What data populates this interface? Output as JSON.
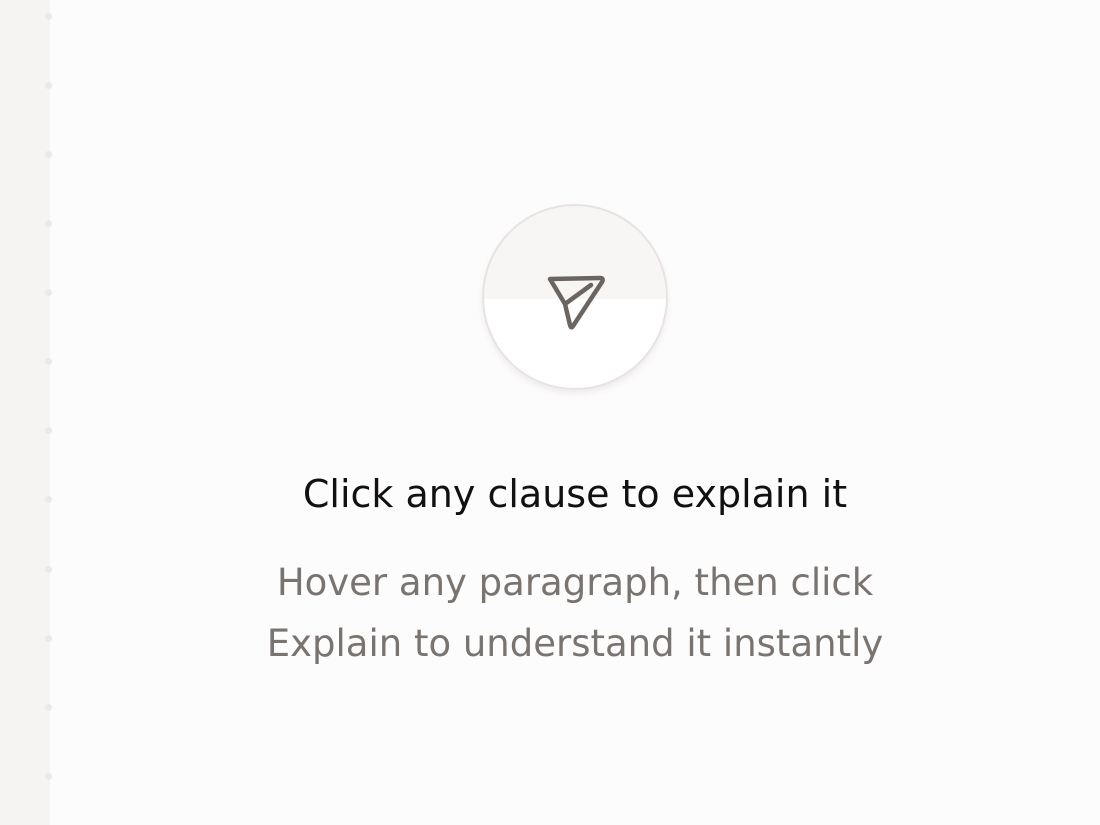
{
  "empty_state": {
    "icon": "send-icon",
    "title": "Click any clause to explain it",
    "subtitle_line1": "Hover any paragraph, then click",
    "subtitle_line2": "Explain to understand it instantly"
  },
  "colors": {
    "background": "#fdfcfc",
    "sidebar_strip": "#f6f3f3",
    "title_text": "#121010",
    "subtitle_text": "#7a7471",
    "icon_stroke": "#6b6562"
  }
}
